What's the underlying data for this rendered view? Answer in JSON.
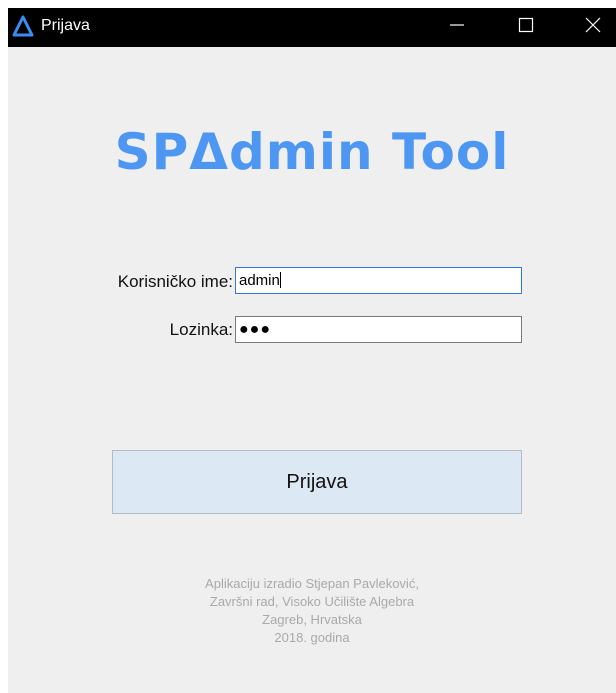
{
  "window": {
    "title": "Prijava"
  },
  "logo": {
    "text": "SPΔdmin Tool"
  },
  "form": {
    "username_label": "Korisničko ime:",
    "username_value": "admin",
    "password_label": "Lozinka:",
    "password_mask": "●●●"
  },
  "login_button": {
    "label": "Prijava"
  },
  "footer": {
    "line1": "Aplikaciju izradio Stjepan Pavleković,",
    "line2": "Završni rad, Visoko Učilište Algebra",
    "line3": "Zagreb, Hrvatska",
    "line4": "2018. godina"
  },
  "icons": {
    "app": "delta-logo-icon",
    "minimize": "minimize-icon",
    "maximize": "maximize-icon",
    "close": "close-icon"
  },
  "colors": {
    "brand": "#4d97f2",
    "window_bg": "#efefef",
    "titlebar_bg": "#000000",
    "button_bg": "#dce8f3",
    "footer_text": "#a9a9a9",
    "focus_border": "#2f7ad6"
  }
}
